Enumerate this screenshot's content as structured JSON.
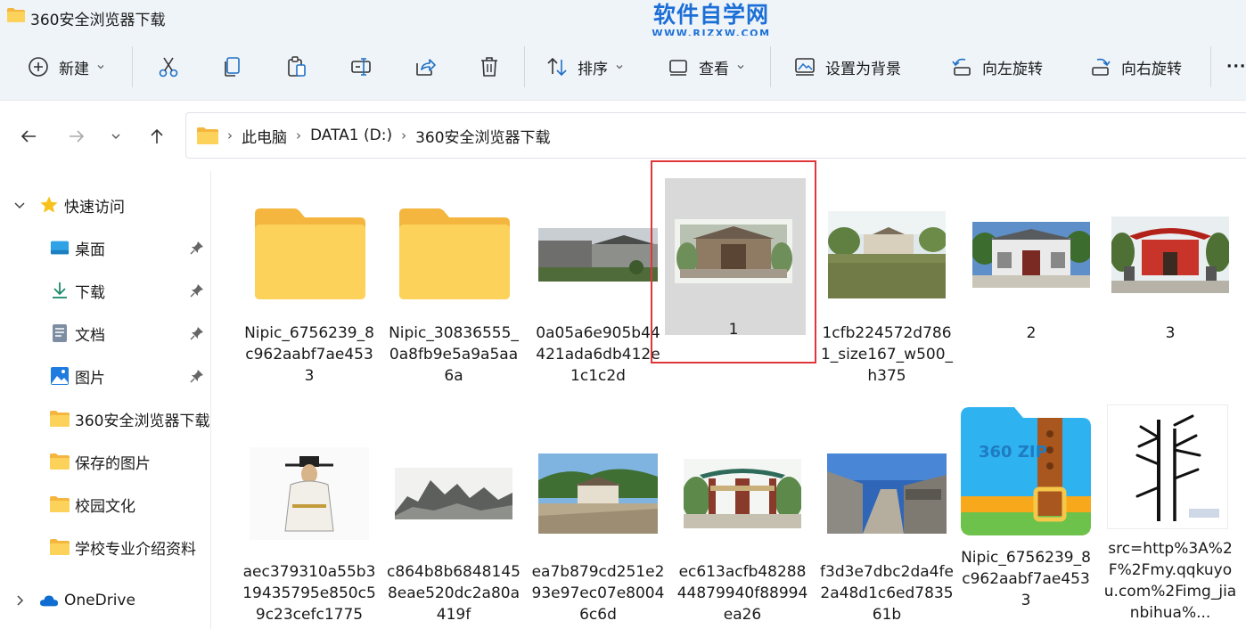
{
  "window": {
    "title": "360安全浏览器下载",
    "watermark_main": "软件自学网",
    "watermark_sub": "WWW.RJZXW.COM"
  },
  "toolbar": {
    "new_label": "新建",
    "sort_label": "排序",
    "view_label": "查看",
    "set_bg_label": "设置为背景",
    "rotate_left_label": "向左旋转",
    "rotate_right_label": "向右旋转",
    "more_label": "···"
  },
  "address": {
    "crumbs": [
      "此电脑",
      "DATA1 (D:)",
      "360安全浏览器下载"
    ]
  },
  "sidebar": {
    "quick_access": "快速访问",
    "items": [
      {
        "label": "桌面",
        "pinned": true
      },
      {
        "label": "下载",
        "pinned": true
      },
      {
        "label": "文档",
        "pinned": true
      },
      {
        "label": "图片",
        "pinned": true
      },
      {
        "label": "360安全浏览器下载",
        "pinned": false
      },
      {
        "label": "保存的图片",
        "pinned": false
      },
      {
        "label": "校园文化",
        "pinned": false
      },
      {
        "label": "学校专业介绍资料",
        "pinned": false
      }
    ],
    "onedrive": "OneDrive"
  },
  "files": {
    "row1": [
      {
        "name": "Nipic_6756239_8c962aabf7ae4533",
        "kind": "folder"
      },
      {
        "name": "Nipic_30836555_0a8fb9e5a9a5aa6a",
        "kind": "folder"
      },
      {
        "name": "0a05a6e905b44421ada6db412e1c1c2d",
        "kind": "photo-village"
      },
      {
        "name": "1",
        "kind": "photo-hall",
        "selected": true
      },
      {
        "name": "1cfb224572d7861_size167_w500_h375",
        "kind": "photo-lake"
      },
      {
        "name": "2",
        "kind": "photo-gate"
      },
      {
        "name": "3",
        "kind": "photo-redgate"
      }
    ],
    "row2": [
      {
        "name": "aec379310a55b319435795e850c59c23cefc1775",
        "kind": "photo-figure"
      },
      {
        "name": "c864b8b68481458eae520dc2a80a419f",
        "kind": "photo-ink"
      },
      {
        "name": "ea7b879cd251e293e97ec07e80046c6d",
        "kind": "photo-square"
      },
      {
        "name": "ec613acfb4828844879940f88994ea26",
        "kind": "photo-arch"
      },
      {
        "name": "f3d3e7dbc2da4fe2a48d1c6ed783561b",
        "kind": "photo-alley"
      },
      {
        "name": "Nipic_6756239_8c962aabf7ae4533",
        "kind": "zip",
        "zip_text": "360 ZIP"
      },
      {
        "name": "src=http%3A%2F%2Fmy.qqkuyou.com%2Fimg_jianbihua%...",
        "kind": "photo-bamboo"
      }
    ]
  },
  "colors": {
    "accent": "#1c6fd6",
    "folder": "#f7c948",
    "highlight": "#e0363a",
    "selection": "#d9d9d9"
  }
}
